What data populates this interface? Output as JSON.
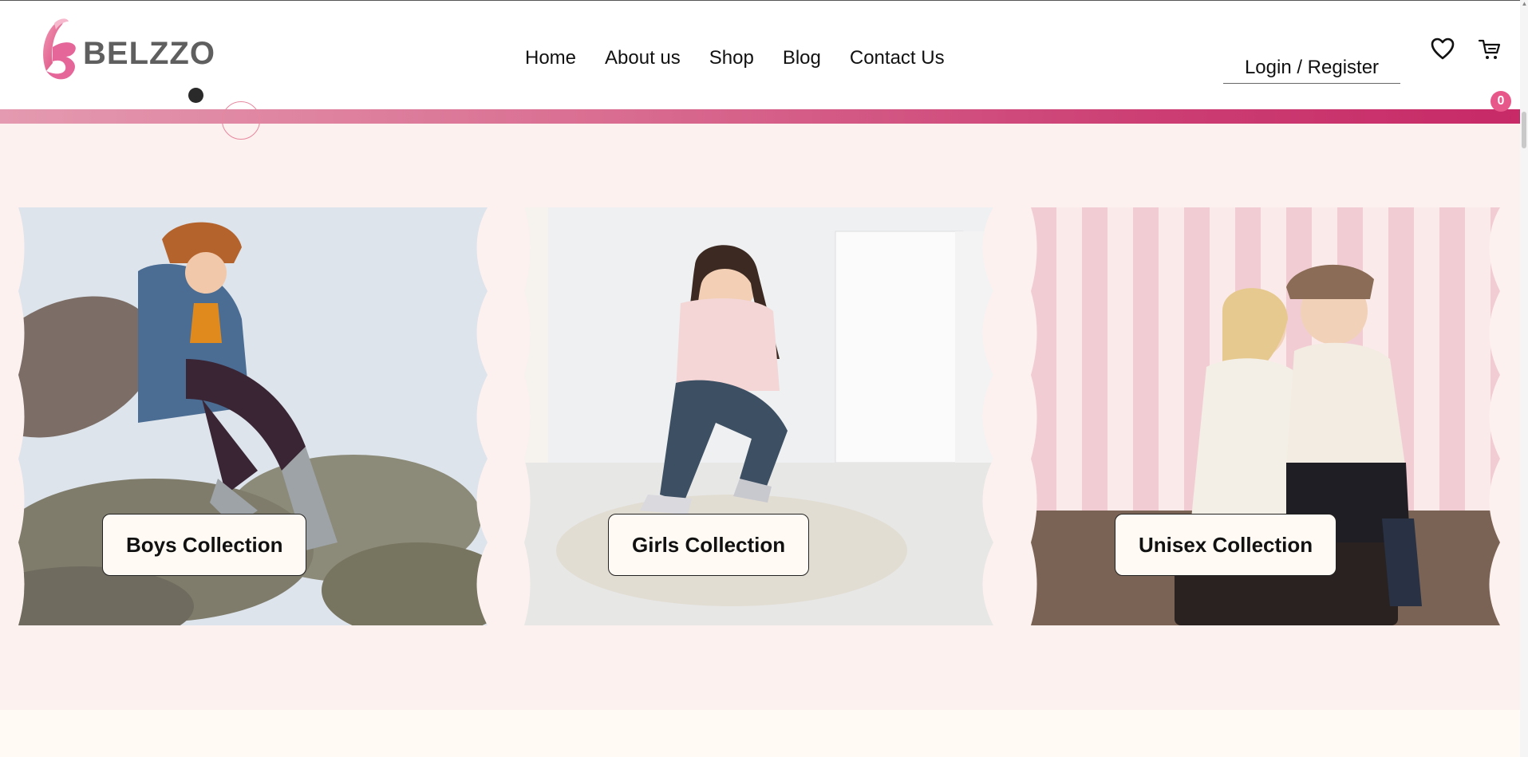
{
  "brand": {
    "name": "BELZZO",
    "logo_icon": "belzzo-b-logo-icon",
    "accent": "#e8578a"
  },
  "nav": {
    "items": [
      {
        "label": "Home"
      },
      {
        "label": "About us"
      },
      {
        "label": "Shop"
      },
      {
        "label": "Blog"
      },
      {
        "label": "Contact Us"
      }
    ]
  },
  "account": {
    "login_label": "Login / Register"
  },
  "icons": {
    "wishlist": "heart-icon",
    "cart": "shopping-cart-icon"
  },
  "cart": {
    "count": "0"
  },
  "collections": [
    {
      "label": "Boys Collection",
      "image": "boy-in-denim-jacket-photo"
    },
    {
      "label": "Girls Collection",
      "image": "girl-tying-shoes-photo"
    },
    {
      "label": "Unisex Collection",
      "image": "girl-and-boy-on-suitcase-photo"
    }
  ],
  "colors": {
    "page_bg": "#fdf1ef",
    "header_bg": "#ffffff",
    "band_start": "#e49ab0",
    "band_end": "#c72a67",
    "button_bg": "#fffaf3"
  }
}
